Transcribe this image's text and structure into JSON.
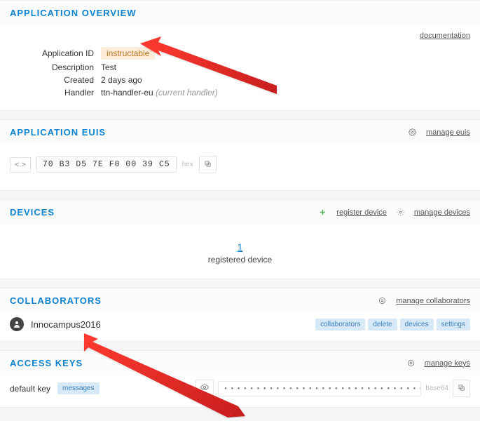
{
  "overview": {
    "title": "APPLICATION OVERVIEW",
    "doc_link": "documentation",
    "fields": {
      "app_id_label": "Application ID",
      "app_id_value": "instructable",
      "description_label": "Description",
      "description_value": "Test",
      "created_label": "Created",
      "created_value": "2 days ago",
      "handler_label": "Handler",
      "handler_value": "ttn-handler-eu",
      "handler_suffix": "(current handler)"
    }
  },
  "euis": {
    "title": "APPLICATION EUIS",
    "manage_label": "manage euis",
    "toggle": "< >",
    "value": "70 B3 D5 7E F0 00 39 C5",
    "encoding": "hex"
  },
  "devices": {
    "title": "DEVICES",
    "register_label": "register device",
    "manage_label": "manage devices",
    "count": "1",
    "label": "registered device"
  },
  "collaborators": {
    "title": "COLLABORATORS",
    "manage_label": "manage collaborators",
    "user": "Innocampus2016",
    "rights": [
      "collaborators",
      "delete",
      "devices",
      "settings"
    ]
  },
  "access_keys": {
    "title": "ACCESS KEYS",
    "manage_label": "manage keys",
    "key_name": "default key",
    "tag": "messages",
    "masked": "● ● ● ● ● ● ● ● ● ● ● ● ● ● ● ● ● ● ● ● ● ● ● ● ● ● ● ● ● ● ● ● ● ● ● ● ● ● ● ● ● ● ● ●",
    "encoding": "base64"
  }
}
